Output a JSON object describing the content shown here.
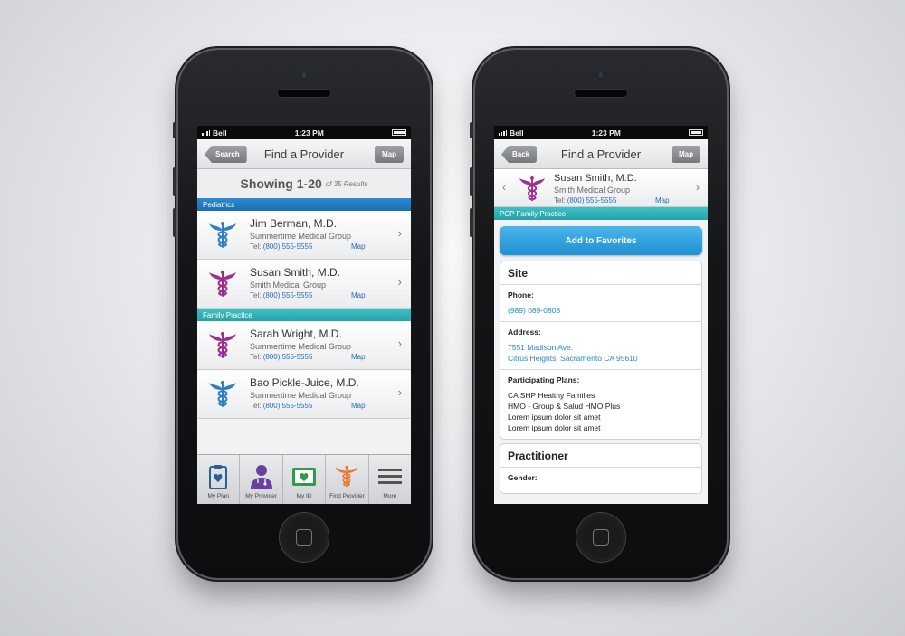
{
  "status": {
    "carrier": "Bell",
    "time": "1:23 PM"
  },
  "left": {
    "nav": {
      "back_label": "Search",
      "title": "Find a Provider",
      "map_label": "Map"
    },
    "showing": {
      "main": "Showing 1-20",
      "sub": "of 35 Results"
    },
    "sections": [
      {
        "label": "Pediatrics",
        "providers": [
          {
            "name": "Jim Berman, M.D.",
            "group": "Summertime Medical Group",
            "tel_label": "Tel:",
            "tel": "(800) 555-5555",
            "map": "Map",
            "icon_color": "#2d7fc4"
          },
          {
            "name": "Susan Smith, M.D.",
            "group": "Smith Medical Group",
            "tel_label": "Tel:",
            "tel": "(800) 555-5555",
            "map": "Map",
            "icon_color": "#9b2d8f"
          }
        ]
      },
      {
        "label": "Family Practice",
        "providers": [
          {
            "name": "Sarah Wright, M.D.",
            "group": "Summertime Medical Group",
            "tel_label": "Tel:",
            "tel": "(800) 555-5555",
            "map": "Map",
            "icon_color": "#9b2d8f"
          },
          {
            "name": "Bao Pickle-Juice, M.D.",
            "group": "Summertime Medical Group",
            "tel_label": "Tel:",
            "tel": "(800) 555-5555",
            "map": "Map",
            "icon_color": "#2d7fc4"
          }
        ]
      }
    ],
    "tabs": [
      {
        "label": "My Plan",
        "icon": "clipboard-heart-icon"
      },
      {
        "label": "My Provider",
        "icon": "doctor-icon"
      },
      {
        "label": "My ID",
        "icon": "id-card-icon"
      },
      {
        "label": "Find Provider",
        "icon": "caduceus-icon"
      },
      {
        "label": "More",
        "icon": "menu-icon"
      }
    ]
  },
  "right": {
    "nav": {
      "back_label": "Back",
      "title": "Find a Provider",
      "map_label": "Map"
    },
    "provider": {
      "name": "Susan Smith, M.D.",
      "group": "Smith Medical Group",
      "tel_label": "Tel:",
      "tel": "(800) 555-5555",
      "map": "Map"
    },
    "section_label": "PCP Family Practice",
    "favorites_label": "Add to Favorites",
    "site": {
      "title": "Site",
      "phone_label": "Phone:",
      "phone": "(989) 089-0808",
      "address_label": "Address:",
      "address_line1": "7551 Madison Ave.",
      "address_line2": "Citrus Heights, Sacramento CA 95610",
      "plans_label": "Participating Plans:",
      "plans": [
        "CA SHP Healthy Families",
        "HMO - Group & Salud HMO Plus",
        "Lorem ipsum dolor sit amet",
        "Lorem ipsum dolor sit amet"
      ]
    },
    "practitioner": {
      "title": "Practitioner",
      "gender_label": "Gender:"
    }
  },
  "colors": {
    "blue_section": "#2e8ad1",
    "teal_section": "#3cc1c6",
    "link": "#2a6db5",
    "caduceus_orange": "#e8772a"
  }
}
